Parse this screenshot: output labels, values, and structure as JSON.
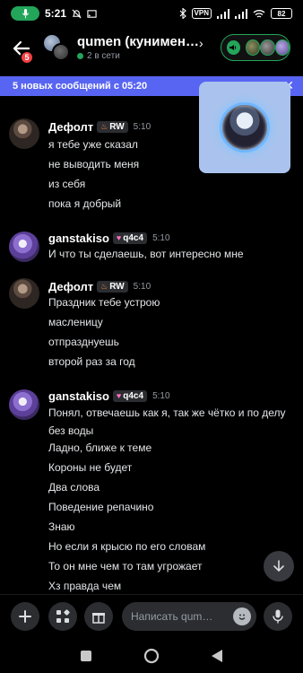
{
  "status_bar": {
    "time": "5:21",
    "vpn": "VPN",
    "battery": "82"
  },
  "header": {
    "back_badge": "5",
    "title": "qumen (кунимен…",
    "online": "2 в сети"
  },
  "banner": {
    "text": "5 новых сообщений с 05:20"
  },
  "messages": [
    {
      "author": "Дефолт",
      "tag": "RW",
      "tag_icon": "fire-icon",
      "time": "5:10",
      "lines": [
        "я тебе уже сказал",
        "не выводить меня",
        "из себя",
        "пока я добрый"
      ]
    },
    {
      "author": "ganstakiso",
      "tag": "q4c4",
      "tag_icon": "heart-icon",
      "time": "5:10",
      "lines": [
        "И что ты сделаешь, вот интересно мне"
      ]
    },
    {
      "author": "Дефолт",
      "tag": "RW",
      "tag_icon": "fire-icon",
      "time": "5:10",
      "lines": [
        "Праздник тебе устрою",
        "масленицу",
        "отпразднуешь",
        "второй раз за год"
      ]
    },
    {
      "author": "ganstakiso",
      "tag": "q4c4",
      "tag_icon": "heart-icon",
      "time": "5:10",
      "lines": [
        "Понял, отвечаешь как я, так же чётко и по делу без воды",
        "Ладно, ближе к теме",
        "Короны не будет",
        "Два слова",
        "Поведение репачино",
        "Знаю",
        "Но если я крысю по его словам",
        "То он мне чем то там угрожает",
        "Хз правда чем"
      ]
    }
  ],
  "composer": {
    "placeholder": "Написать qum…"
  },
  "colors": {
    "accent": "#5865f2",
    "online": "#23a55a",
    "badge": "#f23f43"
  }
}
